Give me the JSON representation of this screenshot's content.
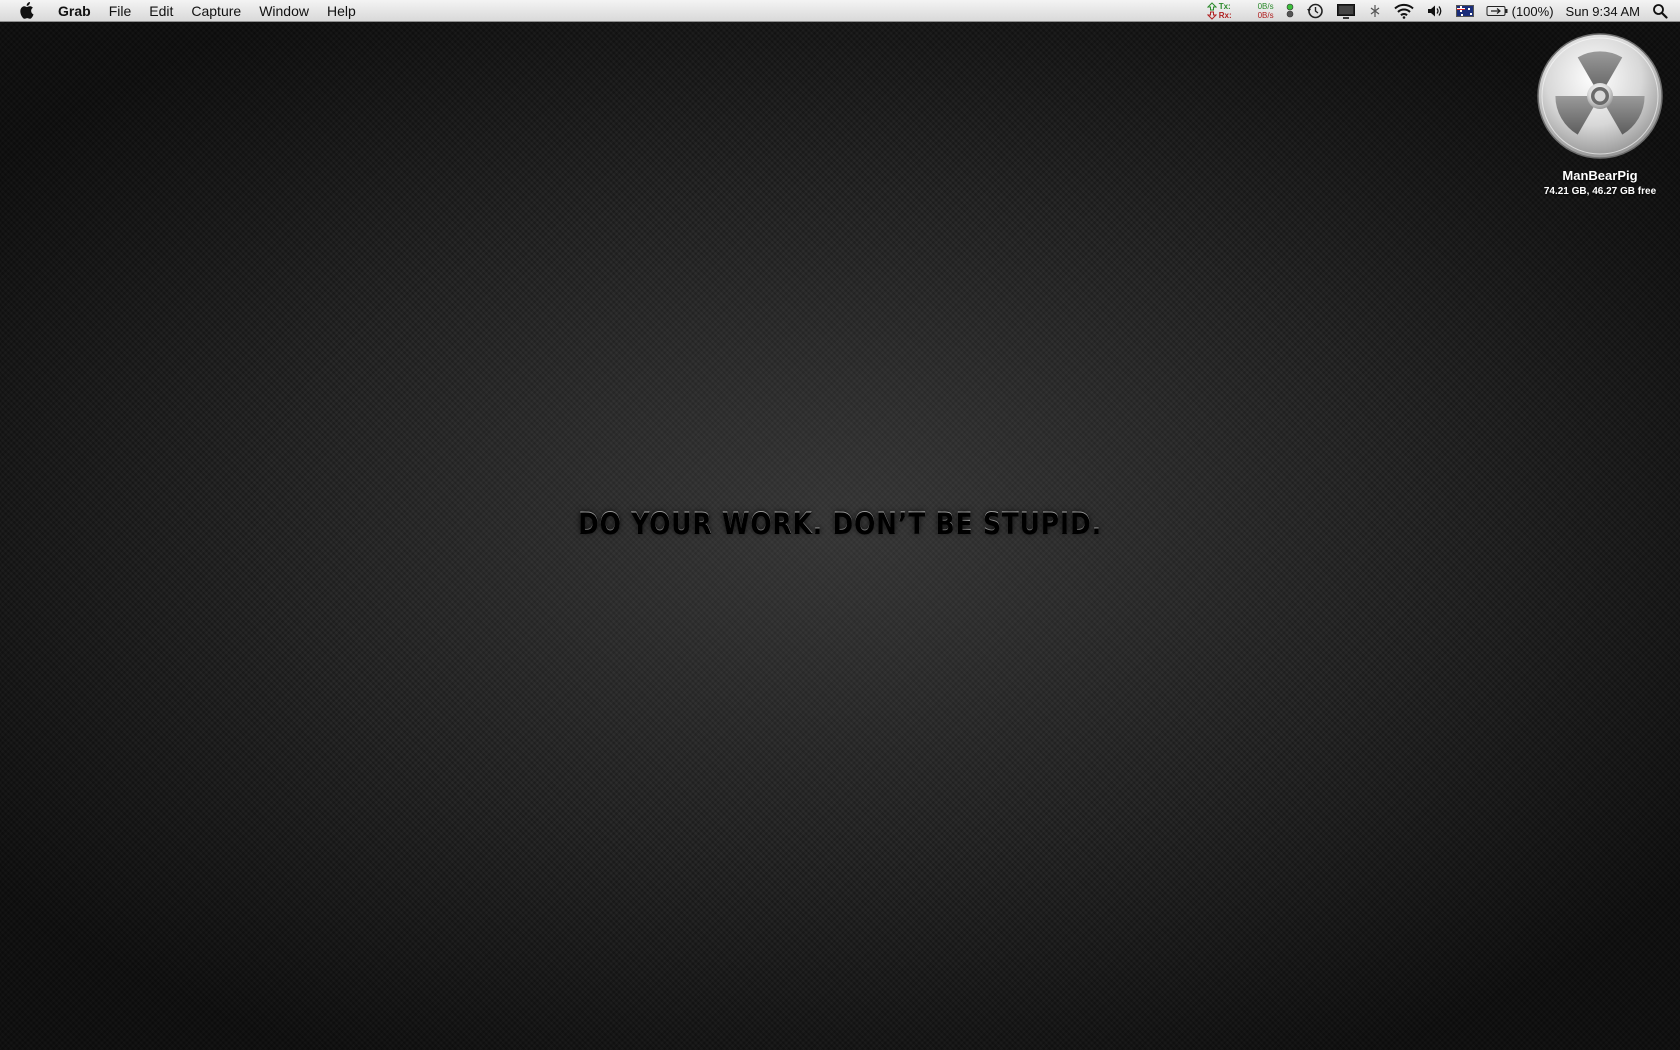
{
  "menubar": {
    "apple_icon": "apple-logo-icon",
    "app_name": "Grab",
    "menus": [
      "File",
      "Edit",
      "Capture",
      "Window",
      "Help"
    ],
    "status": {
      "network": {
        "tx_label": "Tx:",
        "rx_label": "Rx:",
        "tx_value": "0B/s",
        "rx_value": "0B/s"
      },
      "icons": [
        "traffic-light-icon",
        "time-machine-icon",
        "display-icon",
        "bluetooth-icon",
        "wifi-icon",
        "volume-icon",
        "flag-australia-icon",
        "battery-icon",
        "spotlight-icon"
      ],
      "battery_percent": "(100%)",
      "clock": "Sun 9:34 AM"
    }
  },
  "desktop": {
    "drive": {
      "icon": "radiation-drive-icon",
      "name": "ManBearPig",
      "info": "74.21 GB, 46.27 GB free"
    },
    "wallpaper_text": "DO YOUR WORK. DON’T BE STUPID."
  },
  "colors": {
    "menubar_top": "#f4f4f4",
    "menubar_bottom": "#d9d9d9",
    "wallpaper": "#1e1e1e",
    "tx": "#2b8a2b",
    "rx": "#b02020"
  }
}
